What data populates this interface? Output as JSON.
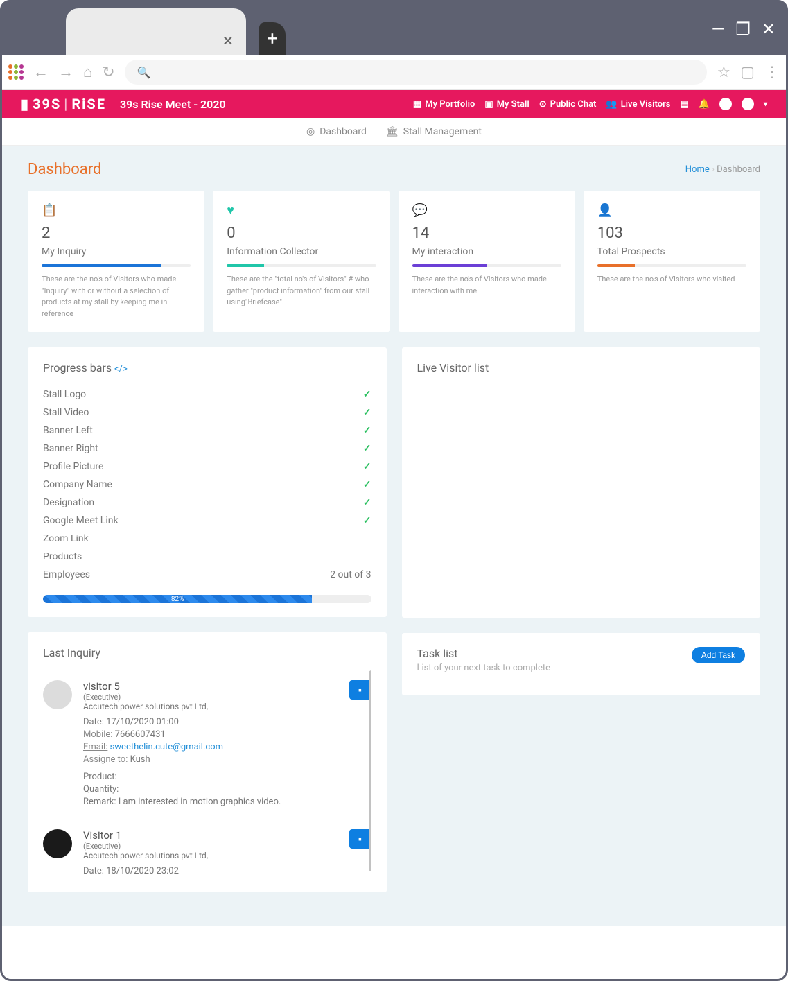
{
  "app_title": "39s Rise Meet - 2020",
  "brand": {
    "left": "39S",
    "right": "RiSE"
  },
  "pink_nav": {
    "portfolio": "My Portfolio",
    "stall": "My Stall",
    "chat": "Public Chat",
    "live": "Live Visitors"
  },
  "subnav": {
    "dashboard": "Dashboard",
    "stallmgmt": "Stall Management"
  },
  "page": {
    "title": "Dashboard",
    "breadcrumb_home": "Home",
    "breadcrumb_current": "Dashboard"
  },
  "stats": [
    {
      "icon": "📋",
      "color": "#1b74d8",
      "value": "2",
      "label": "My Inquiry",
      "barpct": 80,
      "desc": "These are the no's of Visitors who made \"Inquiry\" with or without a selection of products at my stall by keeping me in reference"
    },
    {
      "icon": "♥",
      "color": "#20c6a9",
      "value": "0",
      "label": "Information Collector",
      "barpct": 25,
      "desc": "These are the \"total no's of Visitors\" # who gather \"product information\" from our stall using\"Briefcase\"."
    },
    {
      "icon": "💬",
      "color": "#6b3fd6",
      "value": "14",
      "label": "My interaction",
      "barpct": 50,
      "desc": "These are the no's of Visitors who made interaction with me"
    },
    {
      "icon": "👤",
      "color": "#e8702a",
      "value": "103",
      "label": "Total Prospects",
      "barpct": 25,
      "desc": "These are the no's of Visitors who visited"
    }
  ],
  "progress": {
    "title": "Progress bars",
    "title_icon": "</>'",
    "items": [
      {
        "label": "Stall Logo",
        "done": true
      },
      {
        "label": "Stall Video",
        "done": true
      },
      {
        "label": "Banner Left",
        "done": true
      },
      {
        "label": "Banner Right",
        "done": true
      },
      {
        "label": "Profile Picture",
        "done": true
      },
      {
        "label": "Company Name",
        "done": true
      },
      {
        "label": "Designation",
        "done": true
      },
      {
        "label": "Google Meet Link",
        "done": true
      },
      {
        "label": "Zoom Link",
        "done": false
      },
      {
        "label": "Products",
        "done": false
      },
      {
        "label": "Employees",
        "done": false,
        "right": "2 out of 3"
      }
    ],
    "percent": 82,
    "percent_label": "82%"
  },
  "live": {
    "title": "Live Visitor list"
  },
  "tasks": {
    "title": "Task list",
    "sub": "List of your next task to complete",
    "add_btn": "Add Task"
  },
  "inquiry": {
    "title": "Last Inquiry",
    "items": [
      {
        "name": "visitor 5",
        "role": "(Executive)",
        "company": "Accutech power solutions pvt Ltd,",
        "date": "17/10/2020 01:00",
        "mobile": "7666607431",
        "email": "sweethelin.cute@gmail.com",
        "assignee": "Kush",
        "product": "",
        "quantity": "",
        "remark": "I am interested in motion graphics video.",
        "avatar": "light"
      },
      {
        "name": "Visitor 1",
        "role": "(Executive)",
        "company": "Accutech power solutions pvt Ltd,",
        "date": "18/10/2020 23:02",
        "avatar": "dark"
      }
    ],
    "labels": {
      "date": "Date:",
      "mobile": "Mobile:",
      "email": "Email:",
      "assignee": "Assigne to:",
      "product": "Product:",
      "quantity": "Quantity:",
      "remark": "Remark:"
    }
  }
}
